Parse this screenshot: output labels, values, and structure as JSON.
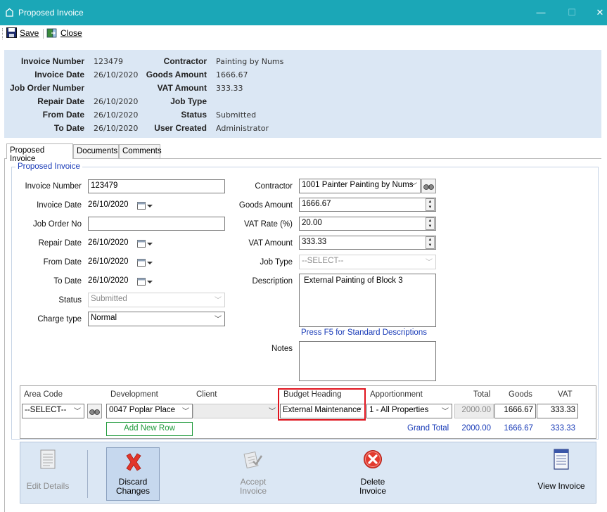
{
  "window": {
    "title": "Proposed Invoice",
    "minimize_glyph": "—",
    "maximize_glyph": "☐",
    "close_glyph": "✕"
  },
  "toolbar": {
    "save_label": "Save",
    "close_label": "Close"
  },
  "header": {
    "left": [
      {
        "label": "Invoice Number",
        "value": "123479"
      },
      {
        "label": "Invoice Date",
        "value": "26/10/2020"
      },
      {
        "label": "Job Order Number",
        "value": ""
      },
      {
        "label": "Repair Date",
        "value": "26/10/2020"
      },
      {
        "label": "From Date",
        "value": "26/10/2020"
      },
      {
        "label": "To Date",
        "value": "26/10/2020"
      }
    ],
    "right": [
      {
        "label": "Contractor",
        "value": "Painting by Nums"
      },
      {
        "label": "Goods Amount",
        "value": "1666.67"
      },
      {
        "label": "VAT Amount",
        "value": "333.33"
      },
      {
        "label": "Job Type",
        "value": ""
      },
      {
        "label": "Status",
        "value": "Submitted"
      },
      {
        "label": "User Created",
        "value": "Administrator"
      }
    ]
  },
  "tabs": [
    {
      "label": "Proposed Invoice",
      "active": true
    },
    {
      "label": "Documents",
      "active": false
    },
    {
      "label": "Comments",
      "active": false
    }
  ],
  "form": {
    "group_title": "Proposed Invoice",
    "invoice_number": {
      "label": "Invoice Number",
      "value": "123479"
    },
    "invoice_date": {
      "label": "Invoice Date",
      "value": "26/10/2020"
    },
    "job_order_no": {
      "label": "Job Order No",
      "value": ""
    },
    "repair_date": {
      "label": "Repair Date",
      "value": "26/10/2020"
    },
    "from_date": {
      "label": "From Date",
      "value": "26/10/2020"
    },
    "to_date": {
      "label": "To Date",
      "value": "26/10/2020"
    },
    "status": {
      "label": "Status",
      "value": "Submitted"
    },
    "charge_type": {
      "label": "Charge type",
      "value": "Normal"
    },
    "contractor": {
      "label": "Contractor",
      "value": "1001 Painter  Painting by Nums"
    },
    "goods_amount": {
      "label": "Goods Amount",
      "value": "1666.67"
    },
    "vat_rate": {
      "label": "VAT Rate (%)",
      "value": "20.00"
    },
    "vat_amount": {
      "label": "VAT Amount",
      "value": "333.33"
    },
    "job_type": {
      "label": "Job Type",
      "value": "--SELECT--"
    },
    "description": {
      "label": "Description",
      "value": "External Painting of Block 3"
    },
    "f5_hint": "Press F5 for Standard Descriptions",
    "notes": {
      "label": "Notes",
      "value": ""
    }
  },
  "grid": {
    "headers": {
      "area_code": "Area Code",
      "development": "Development",
      "client": "Client",
      "budget_heading": "Budget Heading",
      "apportionment": "Apportionment",
      "total": "Total",
      "goods": "Goods",
      "vat": "VAT"
    },
    "row": {
      "area_code": "--SELECT--",
      "development": "0047  Poplar Place",
      "client": "",
      "budget_heading": "External Maintenance",
      "apportionment": "1 - All Properties",
      "total": "2000.00",
      "goods": "1666.67",
      "vat": "333.33"
    },
    "add_row_label": "Add New Row",
    "grand_total_label": "Grand Total",
    "grand_total": {
      "total": "2000.00",
      "goods": "1666.67",
      "vat": "333.33"
    },
    "highlight_color": "#e0141e"
  },
  "actions": [
    {
      "label_1": "Edit Details",
      "label_2": "",
      "enabled": false
    },
    {
      "label_1": "Discard",
      "label_2": "Changes",
      "enabled": true
    },
    {
      "label_1": "Accept",
      "label_2": "Invoice",
      "enabled": false
    },
    {
      "label_1": "Delete",
      "label_2": "Invoice",
      "enabled": true
    },
    {
      "label_1": "View Invoice",
      "label_2": "",
      "enabled": true
    }
  ],
  "colors": {
    "titlebar": "#1ba7b7",
    "panel": "#dbe7f4",
    "link": "#1a3cb8",
    "delete_red": "#e23a2e"
  }
}
